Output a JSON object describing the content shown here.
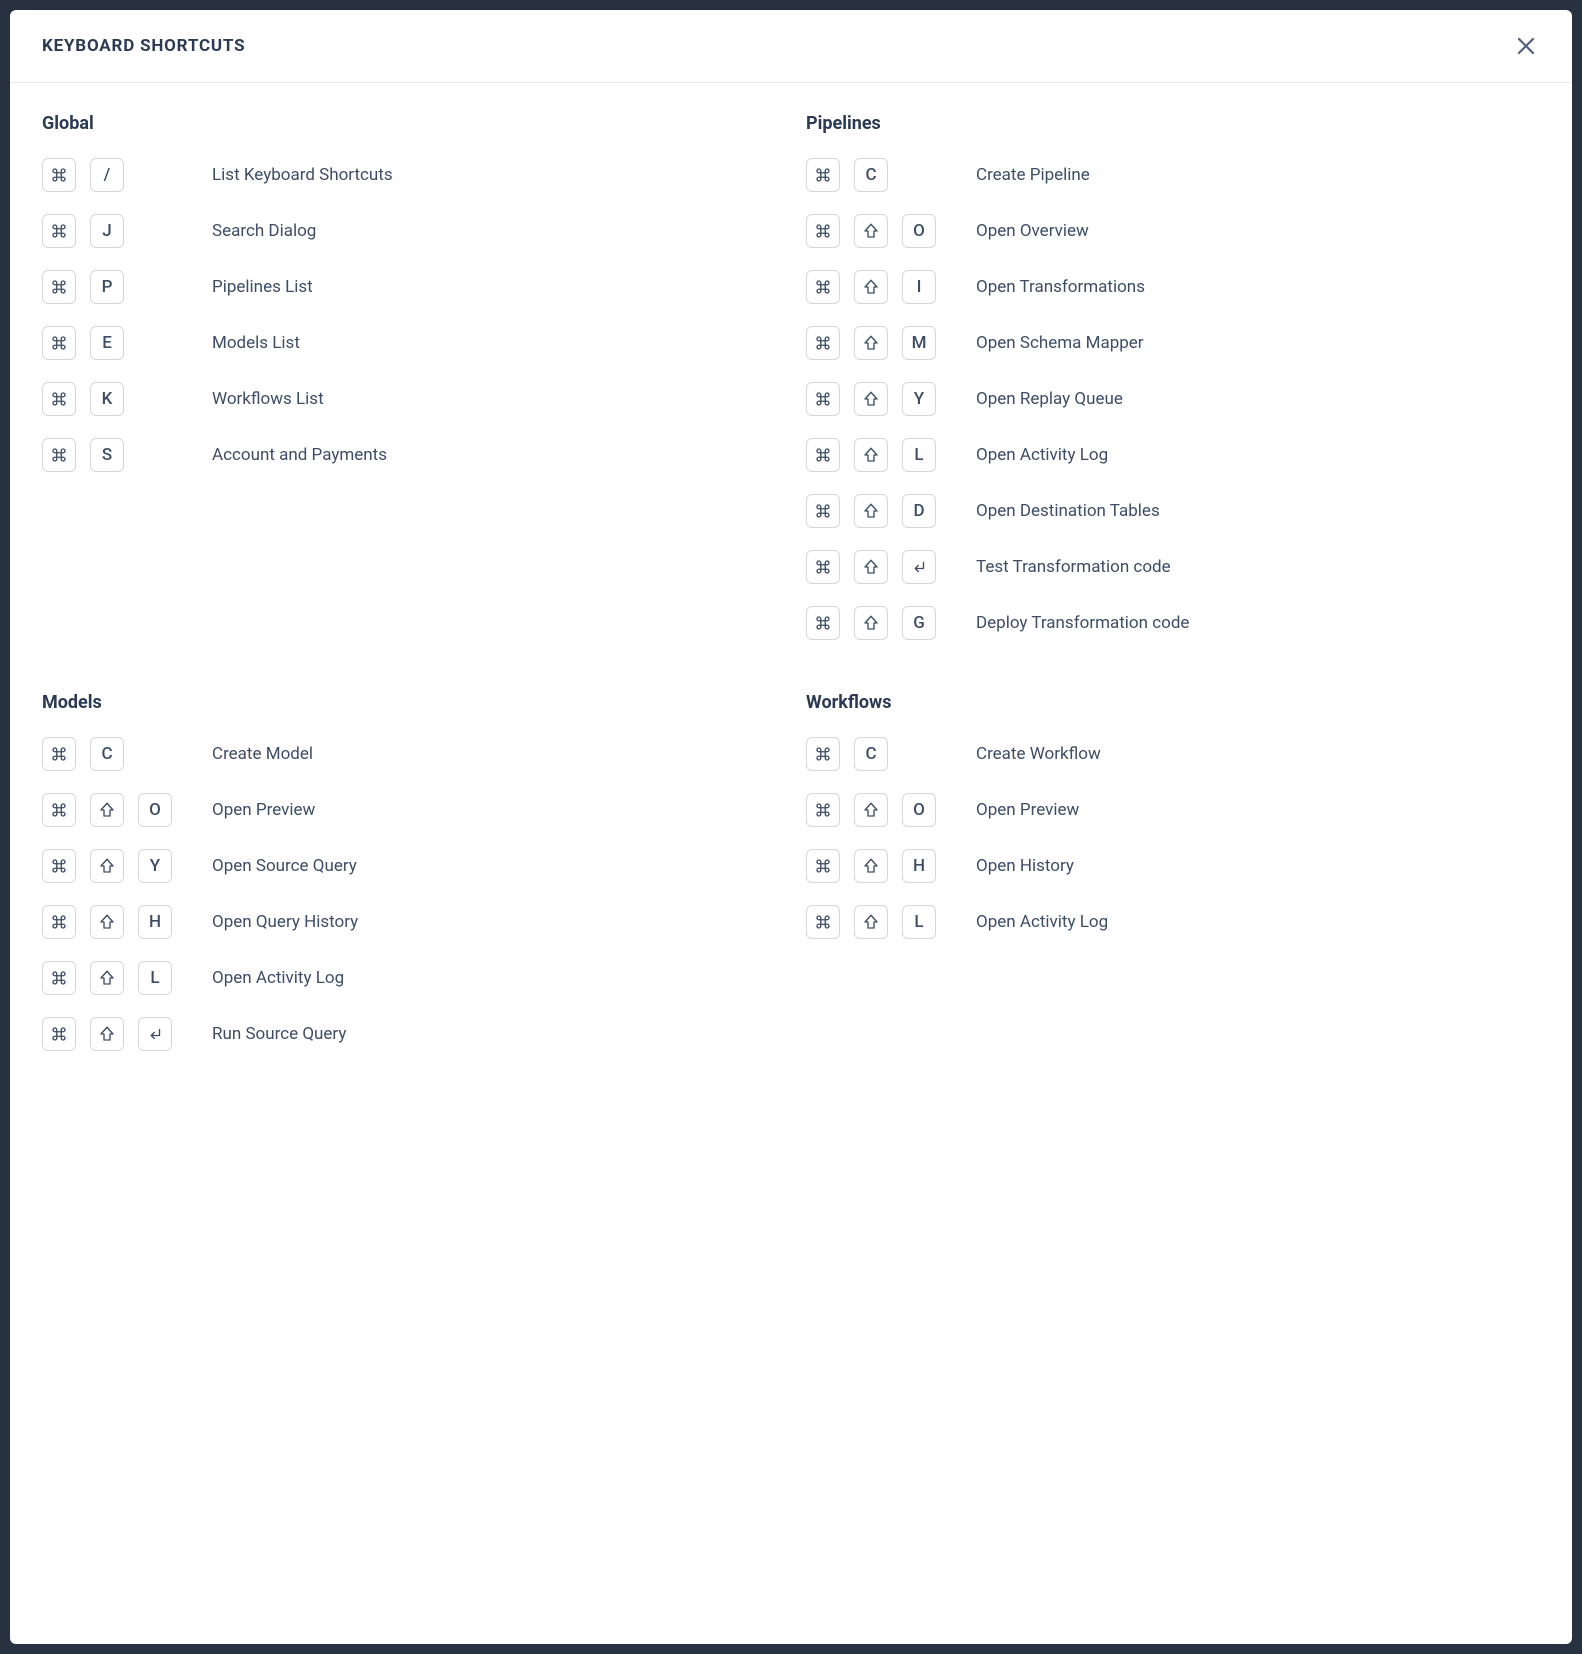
{
  "modal": {
    "title": "KEYBOARD SHORTCUTS"
  },
  "icons": {
    "cmd": "cmd",
    "shift": "shift",
    "enter": "enter"
  },
  "sections": {
    "global": {
      "title": "Global",
      "rows": [
        {
          "keys": [
            "cmd",
            "/"
          ],
          "desc": "List Keyboard Shortcuts"
        },
        {
          "keys": [
            "cmd",
            "J"
          ],
          "desc": "Search Dialog"
        },
        {
          "keys": [
            "cmd",
            "P"
          ],
          "desc": "Pipelines List"
        },
        {
          "keys": [
            "cmd",
            "E"
          ],
          "desc": "Models List"
        },
        {
          "keys": [
            "cmd",
            "K"
          ],
          "desc": "Workflows List"
        },
        {
          "keys": [
            "cmd",
            "S"
          ],
          "desc": "Account and Payments"
        }
      ]
    },
    "pipelines": {
      "title": "Pipelines",
      "rows": [
        {
          "keys": [
            "cmd",
            "C"
          ],
          "desc": "Create Pipeline"
        },
        {
          "keys": [
            "cmd",
            "shift",
            "O"
          ],
          "desc": "Open Overview"
        },
        {
          "keys": [
            "cmd",
            "shift",
            "I"
          ],
          "desc": "Open Transformations"
        },
        {
          "keys": [
            "cmd",
            "shift",
            "M"
          ],
          "desc": "Open Schema Mapper"
        },
        {
          "keys": [
            "cmd",
            "shift",
            "Y"
          ],
          "desc": "Open Replay Queue"
        },
        {
          "keys": [
            "cmd",
            "shift",
            "L"
          ],
          "desc": "Open Activity Log"
        },
        {
          "keys": [
            "cmd",
            "shift",
            "D"
          ],
          "desc": "Open Destination Tables"
        },
        {
          "keys": [
            "cmd",
            "shift",
            "enter"
          ],
          "desc": "Test Transformation code"
        },
        {
          "keys": [
            "cmd",
            "shift",
            "G"
          ],
          "desc": "Deploy Transformation code"
        }
      ]
    },
    "models": {
      "title": "Models",
      "rows": [
        {
          "keys": [
            "cmd",
            "C"
          ],
          "desc": "Create Model"
        },
        {
          "keys": [
            "cmd",
            "shift",
            "O"
          ],
          "desc": "Open Preview"
        },
        {
          "keys": [
            "cmd",
            "shift",
            "Y"
          ],
          "desc": "Open Source Query"
        },
        {
          "keys": [
            "cmd",
            "shift",
            "H"
          ],
          "desc": "Open Query History"
        },
        {
          "keys": [
            "cmd",
            "shift",
            "L"
          ],
          "desc": "Open Activity Log"
        },
        {
          "keys": [
            "cmd",
            "shift",
            "enter"
          ],
          "desc": "Run Source Query"
        }
      ]
    },
    "workflows": {
      "title": "Workflows",
      "rows": [
        {
          "keys": [
            "cmd",
            "C"
          ],
          "desc": "Create Workflow"
        },
        {
          "keys": [
            "cmd",
            "shift",
            "O"
          ],
          "desc": "Open Preview"
        },
        {
          "keys": [
            "cmd",
            "shift",
            "H"
          ],
          "desc": "Open History"
        },
        {
          "keys": [
            "cmd",
            "shift",
            "L"
          ],
          "desc": "Open Activity Log"
        }
      ]
    }
  }
}
